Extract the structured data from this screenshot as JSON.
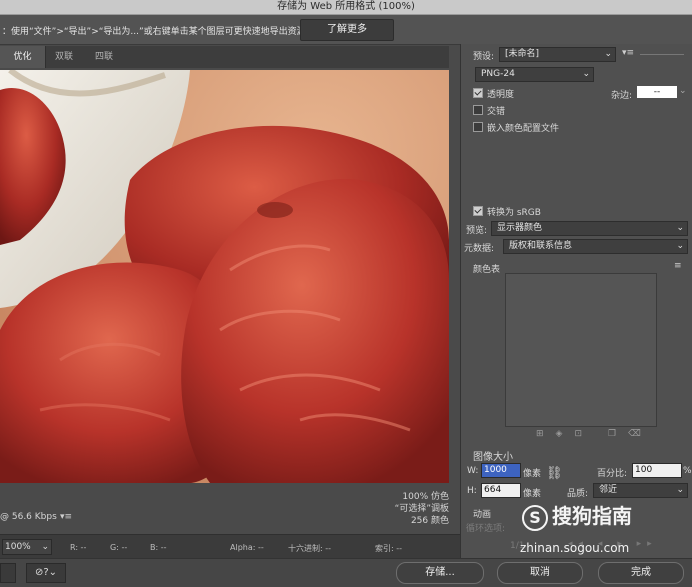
{
  "window": {
    "title": "存储为 Web 所用格式 (100%)"
  },
  "hint": {
    "text": "：使用“文件”>“导出”>“导出为...”或右键单击某个图层可更快速地导出资源",
    "learn_more": "了解更多"
  },
  "tabs": [
    {
      "label": "优化"
    },
    {
      "label": "双联"
    },
    {
      "label": "四联"
    }
  ],
  "image_info": {
    "left": "@ 56.6 Kbps",
    "dither": "100% 仿色",
    "palette": "“可选择”调板",
    "colors": "256 颜色"
  },
  "status": {
    "zoom": "100%",
    "r": "R: --",
    "g": "G: --",
    "b": "B: --",
    "alpha": "Alpha: --",
    "hex": "十六进制: --",
    "index": "索引: --"
  },
  "buttons": {
    "save": "存储...",
    "cancel": "取消",
    "done": "完成"
  },
  "panel": {
    "preset_label": "预设:",
    "preset_value": "[未命名]",
    "format": "PNG-24",
    "transparency": "透明度",
    "matte_label": "杂边:",
    "matte_value": "--",
    "interlaced": "交错",
    "embed_profile": "嵌入颜色配置文件",
    "convert_srgb": "转换为 sRGB",
    "preview_label": "预览:",
    "preview_value": "显示器颜色",
    "metadata_label": "元数据:",
    "metadata_value": "版权和联系信息",
    "color_table": "颜色表",
    "image_size": "图像大小",
    "w_label": "W:",
    "w_value": "1000",
    "h_label": "H:",
    "h_value": "664",
    "px1": "像素",
    "px2": "像素",
    "percent_label": "百分比:",
    "percent_value": "100",
    "percent_unit": "%",
    "quality_label": "品质:",
    "quality_value": "邻近",
    "animation": "动画",
    "loop_label": "循环选项:",
    "frame": "1/1"
  },
  "watermark": {
    "brand": "搜狗指南",
    "url": "zhinan.sogou.com"
  },
  "colors": {
    "accent_field": "#3d63c0"
  }
}
